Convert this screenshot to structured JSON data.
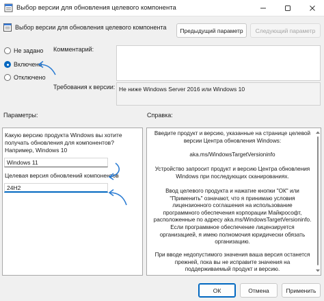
{
  "window": {
    "title": "Выбор версии для обновления целевого компонента",
    "header": "Выбор версии для обновления целевого компонента"
  },
  "buttons": {
    "previous": "Предыдущий параметр",
    "next": "Следующий параметр",
    "ok": "ОК",
    "cancel": "Отмена",
    "apply": "Применить"
  },
  "state_options": [
    {
      "label": "Не задано",
      "checked": false
    },
    {
      "label": "Включено",
      "checked": true
    },
    {
      "label": "Отключено",
      "checked": false
    }
  ],
  "comment_label": "Комментарий:",
  "requirements_label": "Требования к версии:",
  "requirements_value": "Не ниже Windows Server 2016 или Windows 10",
  "options_label": "Параметры:",
  "help_label": "Справка:",
  "options": {
    "question_line1": "Какую версию продукта Windows вы хотите",
    "question_line2": "получать обновления для компонентов?",
    "question_line3": "Например, Windows 10",
    "product_value": "Windows 11",
    "target_label": "Целевая версия обновлений компонентов",
    "target_value": "24H2"
  },
  "help": {
    "p1_l1": "Введите продукт и версию, указанные на странице целевой",
    "p1_l2": "версии Центра обновления Windows:",
    "link": "aka.ms/WindowsTargetVersioninfo",
    "p2_l1": "Устройство запросит продукт и версию Центра обновления",
    "p2_l2": "Windows при последующих сканированиях.",
    "p3_l1": "Ввод целевого продукта и нажатие кнопки \"ОК\" или",
    "p3_l2": "\"Применить\" означают, что я принимаю условия",
    "p3_l3": "лицензионного соглашения на использование",
    "p3_l4": "программного обеспечения корпорации Майкрософт,",
    "p3_l5": "расположенные по адресу aka.ms/WindowsTargetVersioninfo.",
    "p3_l6": "Если программное обеспечение лицензируется",
    "p3_l7": "организацией, я имею полномочия юридически обязать",
    "p3_l8": "организацию.",
    "p4_l1": "При вводе недопустимого значения ваша версия останется",
    "p4_l2": "прежней, пока вы не исправите значения на",
    "p4_l3": "поддерживаемый продукт и версию."
  },
  "colors": {
    "accent": "#0067c0",
    "annotation": "#2b7cd3"
  }
}
